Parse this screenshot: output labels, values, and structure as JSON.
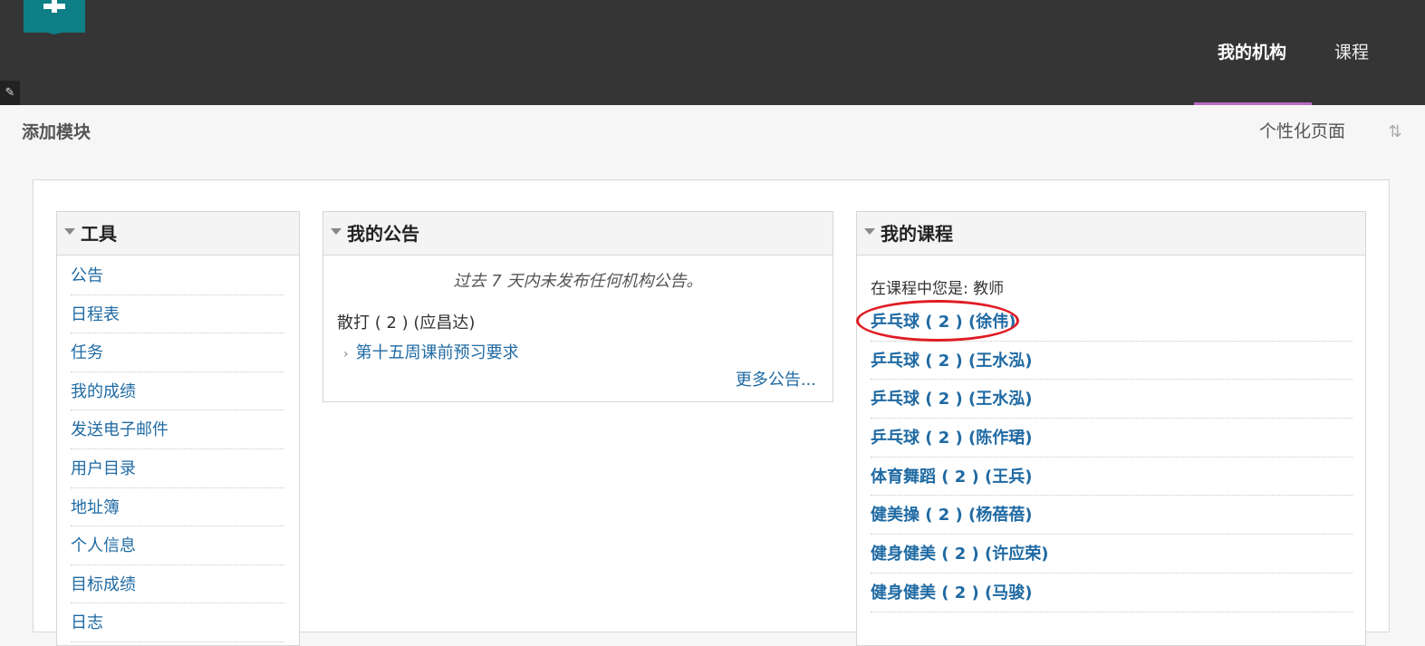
{
  "header": {
    "nav_tabs": [
      {
        "label": "我的机构",
        "active": true
      },
      {
        "label": "课程",
        "active": false
      }
    ],
    "accent_color": "#b96ac4",
    "bg_color": "#353535"
  },
  "module_bar": {
    "add_module_label": "添加模块",
    "personalize_label": "个性化页面"
  },
  "tools": {
    "title": "工具",
    "items": [
      "公告",
      "日程表",
      "任务",
      "我的成绩",
      "发送电子邮件",
      "用户目录",
      "地址簿",
      "个人信息",
      "目标成绩",
      "日志"
    ]
  },
  "announcements": {
    "title": "我的公告",
    "empty_text": "过去 7 天内未发布任何机构公告。",
    "course_label": "散打 ( 2 ) (应昌达)",
    "item_label": "第十五周课前预习要求",
    "more_label": "更多公告..."
  },
  "courses": {
    "title": "我的课程",
    "role_text": "在课程中您是: 教师",
    "items": [
      "乒乓球 ( 2 ) (徐伟)",
      "乒乓球 ( 2 ) (王水泓)",
      "乒乓球 ( 2 ) (王水泓)",
      "乒乓球 ( 2 ) (陈作珺)",
      "体育舞蹈 ( 2 ) (王兵)",
      "健美操 ( 2 ) (杨蓓蓓)",
      "健身健美 ( 2 ) (许应荣)",
      "健身健美 ( 2 ) (马骏)"
    ]
  }
}
